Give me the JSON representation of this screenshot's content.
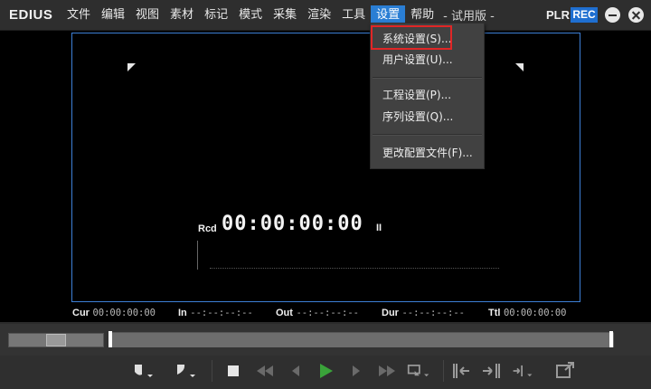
{
  "app": {
    "logo": "EDIUS",
    "trial": "- 试用版 -",
    "plr": "PLR",
    "rec": "REC"
  },
  "menu": [
    "文件",
    "编辑",
    "视图",
    "素材",
    "标记",
    "模式",
    "采集",
    "渲染",
    "工具",
    "设置",
    "帮助"
  ],
  "active_menu": "设置",
  "dropdown": {
    "items": [
      "系统设置(S)...",
      "用户设置(U)...",
      "工程设置(P)...",
      "序列设置(Q)...",
      "更改配置文件(F)..."
    ],
    "highlighted": "系统设置(S)..."
  },
  "viewer": {
    "tc_label": "Rcd",
    "tc_value": "00:00:00:00",
    "tc_pause": "II"
  },
  "timecodes": {
    "cur_label": "Cur",
    "cur_value": "00:00:00:00",
    "in_label": "In",
    "in_value": "--:--:--:--",
    "out_label": "Out",
    "out_value": "--:--:--:--",
    "dur_label": "Dur",
    "dur_value": "--:--:--:--",
    "ttl_label": "Ttl",
    "ttl_value": "00:00:00:00"
  },
  "controls": [
    "mark-in-icon",
    "mark-out-icon",
    "stop-icon",
    "rewind-icon",
    "step-back-icon",
    "play-icon",
    "step-forward-icon",
    "fast-forward-icon",
    "loop-icon",
    "insert-icon",
    "overwrite-icon",
    "export-icon",
    "output-icon"
  ],
  "colors": {
    "accent": "#2a7ed4",
    "rec": "#1f6fd1",
    "highlight": "#e02626",
    "play": "#3aa33a"
  }
}
